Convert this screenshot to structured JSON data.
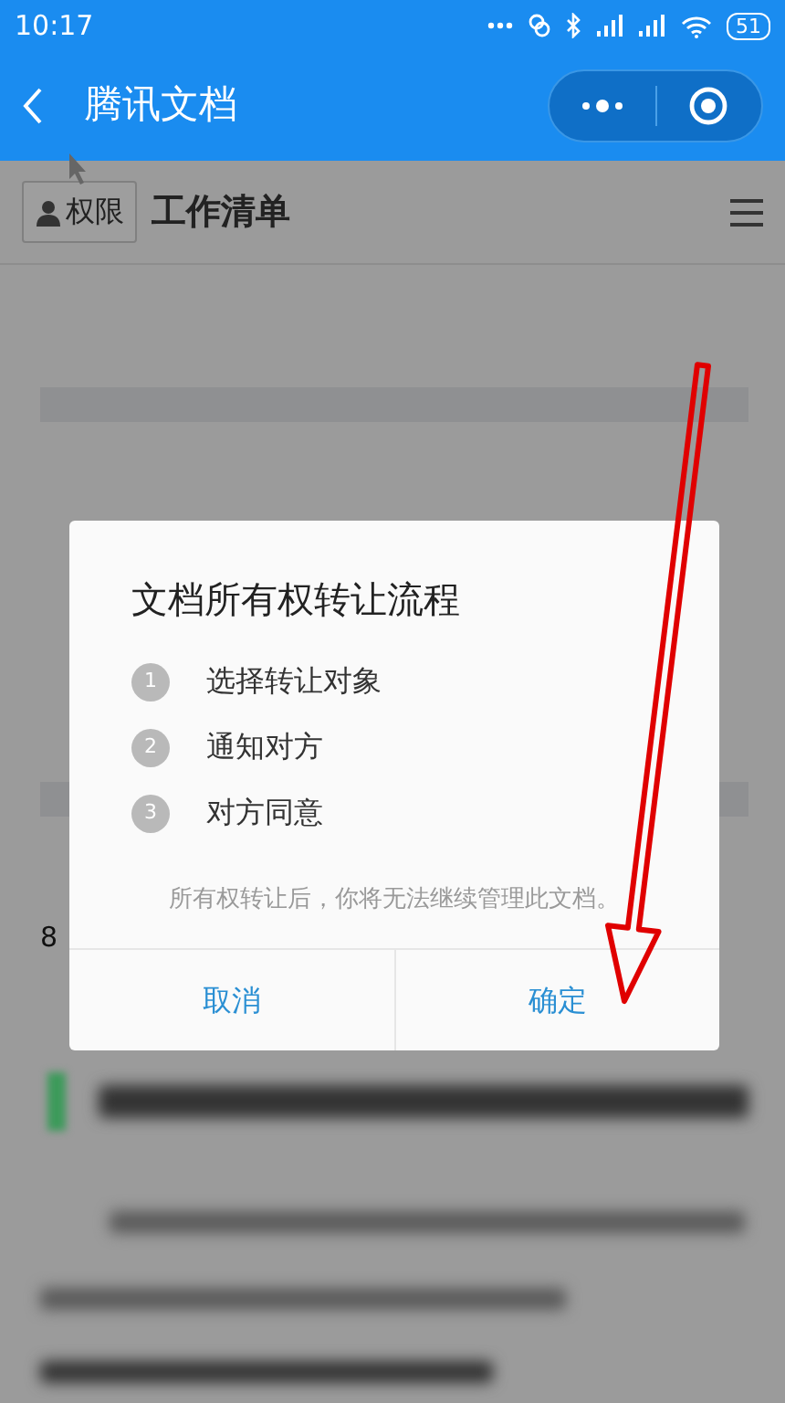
{
  "status_bar": {
    "time": "10:17",
    "battery": "51"
  },
  "nav_bar": {
    "title": "腾讯文档"
  },
  "toolbar": {
    "permission_button": "权限",
    "document_title": "工作清单"
  },
  "page": {
    "row_number": "8"
  },
  "dialog": {
    "title": "文档所有权转让流程",
    "steps": [
      {
        "number": "1",
        "label": "选择转让对象"
      },
      {
        "number": "2",
        "label": "通知对方"
      },
      {
        "number": "3",
        "label": "对方同意"
      }
    ],
    "note": "所有权转让后，你将无法继续管理此文档。",
    "buttons": [
      "取消",
      "确定"
    ]
  }
}
